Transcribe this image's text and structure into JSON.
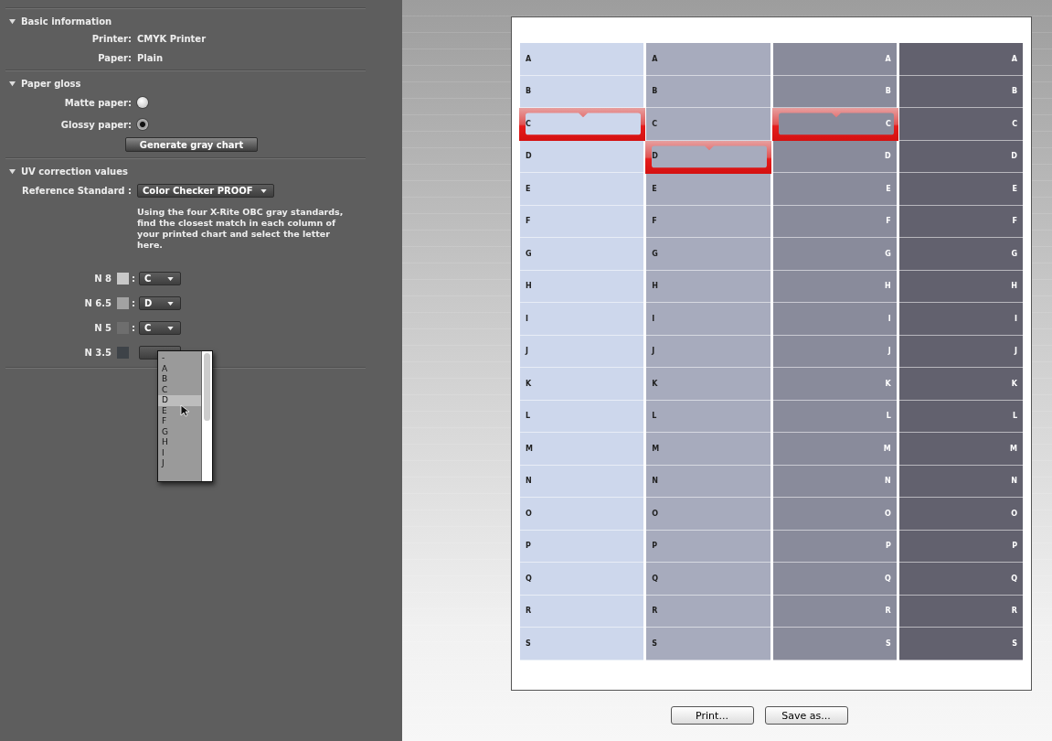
{
  "basic_information": {
    "title": "Basic information",
    "expanded": true,
    "fields": [
      {
        "label": "Printer:",
        "value": "CMYK Printer"
      },
      {
        "label": "Paper:",
        "value": "Plain"
      }
    ]
  },
  "paper_gloss": {
    "title": "Paper gloss",
    "expanded": true,
    "options": [
      {
        "label": "Matte paper:",
        "selected": false
      },
      {
        "label": "Glossy paper:",
        "selected": true
      }
    ],
    "button": "Generate gray chart"
  },
  "uv_correction": {
    "title": "UV correction values",
    "expanded": true,
    "reference_label": "Reference Standard :",
    "reference_value": "Color Checker PROOF",
    "description": "Using the four X-Rite OBC gray standards, find the closest match in each column of your printed chart and select the letter here.",
    "standards": [
      {
        "label": "N 8",
        "color": "#c8c8c8",
        "separator": ":",
        "value": "C"
      },
      {
        "label": "N 6.5",
        "color": "#a2a2a2",
        "separator": ":",
        "value": "D"
      },
      {
        "label": "N 5",
        "color": "#6e6e6e",
        "separator": ":",
        "value": "C"
      },
      {
        "label": "N 3.5",
        "color": "#3e4348"
      }
    ],
    "open_menu": {
      "items": [
        {
          "label": "-",
          "selected": false
        },
        {
          "label": "A",
          "selected": false
        },
        {
          "label": "B",
          "selected": false
        },
        {
          "label": "C",
          "selected": false
        },
        {
          "label": "D",
          "selected": true
        },
        {
          "label": "E",
          "selected": false
        },
        {
          "label": "F",
          "selected": false
        },
        {
          "label": "G",
          "selected": false
        },
        {
          "label": "H",
          "selected": false
        },
        {
          "label": "I",
          "selected": false
        },
        {
          "label": "J",
          "selected": false
        }
      ]
    }
  },
  "chart": {
    "columns": [
      {
        "color": "#cdd7ec",
        "kind": "dark",
        "rows": [
          {
            "label": "A",
            "selected": false
          },
          {
            "label": "B",
            "selected": false
          },
          {
            "label": "C",
            "selected": true
          },
          {
            "label": "D",
            "selected": false
          },
          {
            "label": "E",
            "selected": false
          },
          {
            "label": "F",
            "selected": false
          },
          {
            "label": "G",
            "selected": false
          },
          {
            "label": "H",
            "selected": false
          },
          {
            "label": "I",
            "selected": false
          },
          {
            "label": "J",
            "selected": false
          },
          {
            "label": "K",
            "selected": false
          },
          {
            "label": "L",
            "selected": false
          },
          {
            "label": "M",
            "selected": false
          },
          {
            "label": "N",
            "selected": false
          },
          {
            "label": "O",
            "selected": false
          },
          {
            "label": "P",
            "selected": false
          },
          {
            "label": "Q",
            "selected": false
          },
          {
            "label": "R",
            "selected": false
          },
          {
            "label": "S",
            "selected": false
          }
        ]
      },
      {
        "color": "#a7abbd",
        "kind": "dark",
        "rows": [
          {
            "label": "A",
            "selected": false
          },
          {
            "label": "B",
            "selected": false
          },
          {
            "label": "C",
            "selected": false
          },
          {
            "label": "D",
            "selected": true
          },
          {
            "label": "E",
            "selected": false
          },
          {
            "label": "F",
            "selected": false
          },
          {
            "label": "G",
            "selected": false
          },
          {
            "label": "H",
            "selected": false
          },
          {
            "label": "I",
            "selected": false
          },
          {
            "label": "J",
            "selected": false
          },
          {
            "label": "K",
            "selected": false
          },
          {
            "label": "L",
            "selected": false
          },
          {
            "label": "M",
            "selected": false
          },
          {
            "label": "N",
            "selected": false
          },
          {
            "label": "O",
            "selected": false
          },
          {
            "label": "P",
            "selected": false
          },
          {
            "label": "Q",
            "selected": false
          },
          {
            "label": "R",
            "selected": false
          },
          {
            "label": "S",
            "selected": false
          }
        ]
      },
      {
        "color": "#898b9b",
        "kind": "light",
        "rows": [
          {
            "label": "A",
            "selected": false
          },
          {
            "label": "B",
            "selected": false
          },
          {
            "label": "C",
            "selected": true
          },
          {
            "label": "D",
            "selected": false
          },
          {
            "label": "E",
            "selected": false
          },
          {
            "label": "F",
            "selected": false
          },
          {
            "label": "G",
            "selected": false
          },
          {
            "label": "H",
            "selected": false
          },
          {
            "label": "I",
            "selected": false
          },
          {
            "label": "J",
            "selected": false
          },
          {
            "label": "K",
            "selected": false
          },
          {
            "label": "L",
            "selected": false
          },
          {
            "label": "M",
            "selected": false
          },
          {
            "label": "N",
            "selected": false
          },
          {
            "label": "O",
            "selected": false
          },
          {
            "label": "P",
            "selected": false
          },
          {
            "label": "Q",
            "selected": false
          },
          {
            "label": "R",
            "selected": false
          },
          {
            "label": "S",
            "selected": false
          }
        ]
      },
      {
        "color": "#62616e",
        "kind": "light",
        "rows": [
          {
            "label": "A",
            "selected": false
          },
          {
            "label": "B",
            "selected": false
          },
          {
            "label": "C",
            "selected": false
          },
          {
            "label": "D",
            "selected": false
          },
          {
            "label": "E",
            "selected": false
          },
          {
            "label": "F",
            "selected": false
          },
          {
            "label": "G",
            "selected": false
          },
          {
            "label": "H",
            "selected": false
          },
          {
            "label": "I",
            "selected": false
          },
          {
            "label": "J",
            "selected": false
          },
          {
            "label": "K",
            "selected": false
          },
          {
            "label": "L",
            "selected": false
          },
          {
            "label": "M",
            "selected": false
          },
          {
            "label": "N",
            "selected": false
          },
          {
            "label": "O",
            "selected": false
          },
          {
            "label": "P",
            "selected": false
          },
          {
            "label": "Q",
            "selected": false
          },
          {
            "label": "R",
            "selected": false
          },
          {
            "label": "S",
            "selected": false
          }
        ]
      }
    ]
  },
  "buttons": [
    "Print...",
    "Save as..."
  ]
}
